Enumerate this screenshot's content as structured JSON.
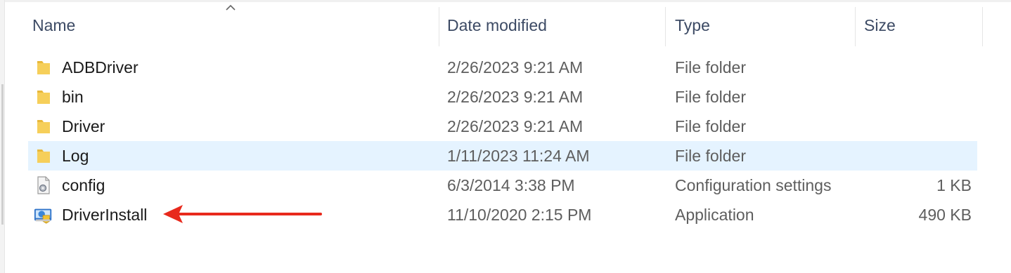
{
  "columns": {
    "name": "Name",
    "date": "Date modified",
    "type": "Type",
    "size": "Size"
  },
  "files": [
    {
      "name": "ADBDriver",
      "date": "2/26/2023 9:21 AM",
      "type": "File folder",
      "size": "",
      "icon": "folder-icon",
      "selected": false
    },
    {
      "name": "bin",
      "date": "2/26/2023 9:21 AM",
      "type": "File folder",
      "size": "",
      "icon": "folder-icon",
      "selected": false
    },
    {
      "name": "Driver",
      "date": "2/26/2023 9:21 AM",
      "type": "File folder",
      "size": "",
      "icon": "folder-icon",
      "selected": false
    },
    {
      "name": "Log",
      "date": "1/11/2023 11:24 AM",
      "type": "File folder",
      "size": "",
      "icon": "folder-icon",
      "selected": true
    },
    {
      "name": "config",
      "date": "6/3/2014 3:38 PM",
      "type": "Configuration settings",
      "size": "1 KB",
      "icon": "config-file-icon",
      "selected": false
    },
    {
      "name": "DriverInstall",
      "date": "11/10/2020 2:15 PM",
      "type": "Application",
      "size": "490 KB",
      "icon": "application-icon",
      "selected": false
    }
  ],
  "colors": {
    "selected_row": "#e5f3ff",
    "annotation_arrow": "#e8291c",
    "folder": "#f3c94b"
  }
}
